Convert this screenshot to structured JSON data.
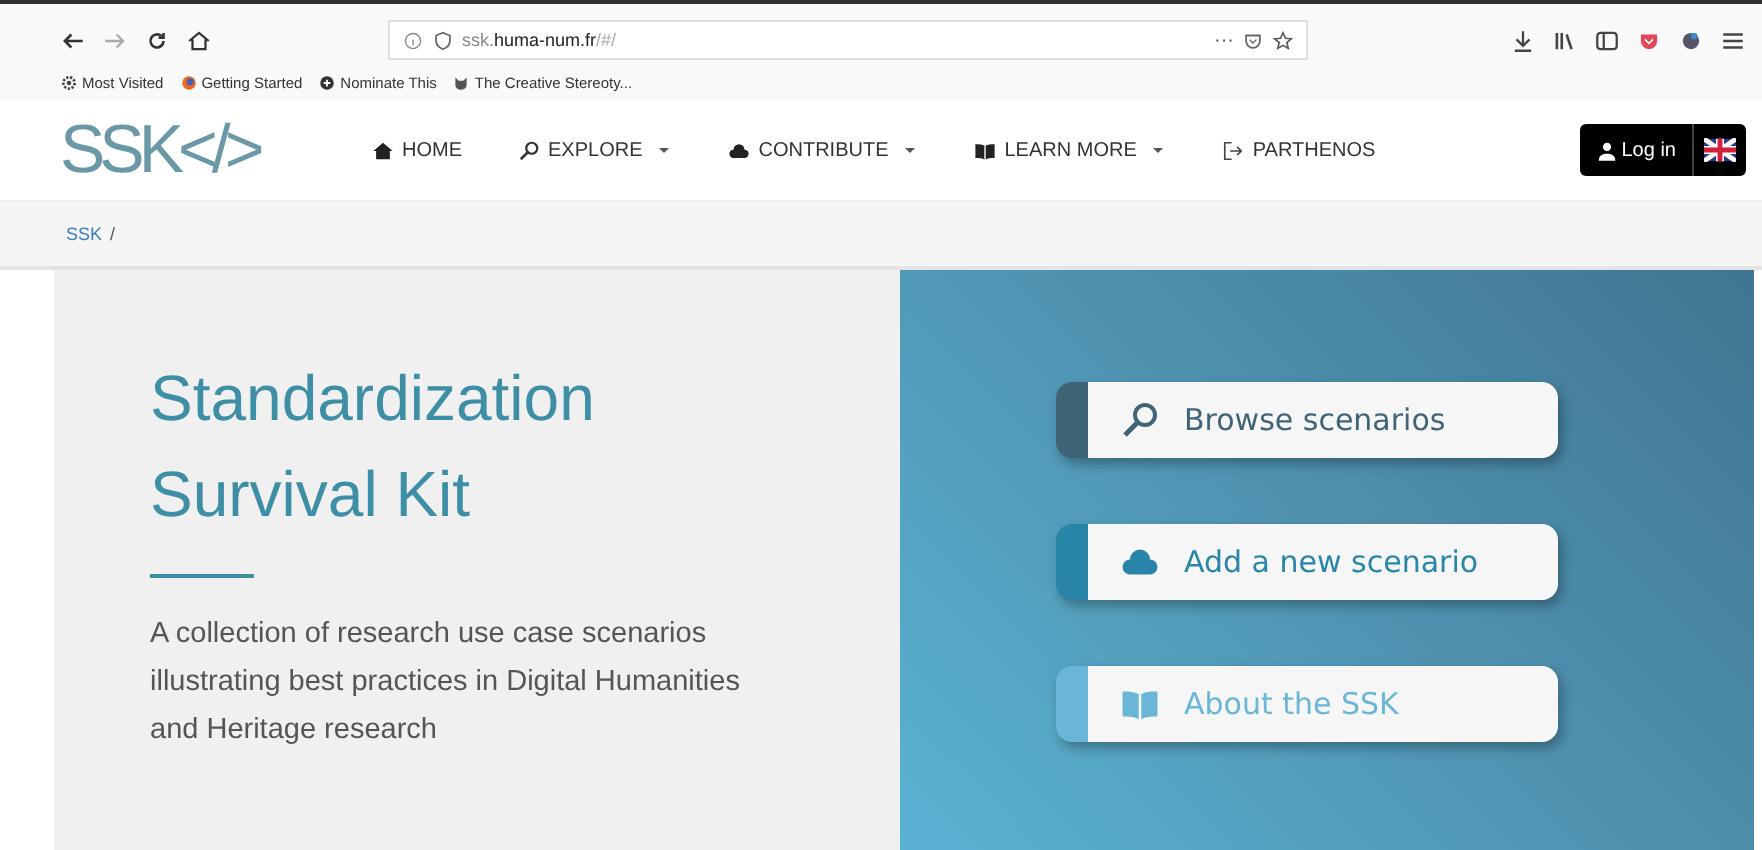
{
  "browser": {
    "url_host": "ssk.",
    "url_domain": "huma-num.fr",
    "url_path": "/#/",
    "page_actions": "···",
    "bookmarks": [
      {
        "kind": "gear",
        "label": "Most Visited"
      },
      {
        "kind": "firefox",
        "label": "Getting Started"
      },
      {
        "kind": "plus",
        "label": "Nominate This"
      },
      {
        "kind": "cat",
        "label": "The Creative Stereoty..."
      }
    ]
  },
  "site": {
    "logo": "SSK</>",
    "nav": [
      {
        "kind": "home",
        "label": "HOME",
        "dropdown": false
      },
      {
        "kind": "search",
        "label": "EXPLORE",
        "dropdown": true
      },
      {
        "kind": "cloud",
        "label": "CONTRIBUTE",
        "dropdown": true
      },
      {
        "kind": "book",
        "label": "LEARN MORE",
        "dropdown": true
      },
      {
        "kind": "exit",
        "label": "PARTHENOS",
        "dropdown": false
      }
    ],
    "login": "Log in"
  },
  "breadcrumb": [
    {
      "label": "SSK"
    },
    {
      "label": "/"
    }
  ],
  "hero": {
    "title_lines": [
      "Standardization",
      "Survival Kit"
    ],
    "description": "A collection of research use case scenarios illustrating best practices in Digital Humanities and Heritage research",
    "actions": [
      {
        "kind": "search",
        "label": "Browse scenarios",
        "color": "#3f6477"
      },
      {
        "kind": "cloud",
        "label": "Add a new scenario",
        "color": "#2a86a8"
      },
      {
        "kind": "book",
        "label": "About the SSK",
        "color": "#6ab6d8"
      }
    ]
  }
}
